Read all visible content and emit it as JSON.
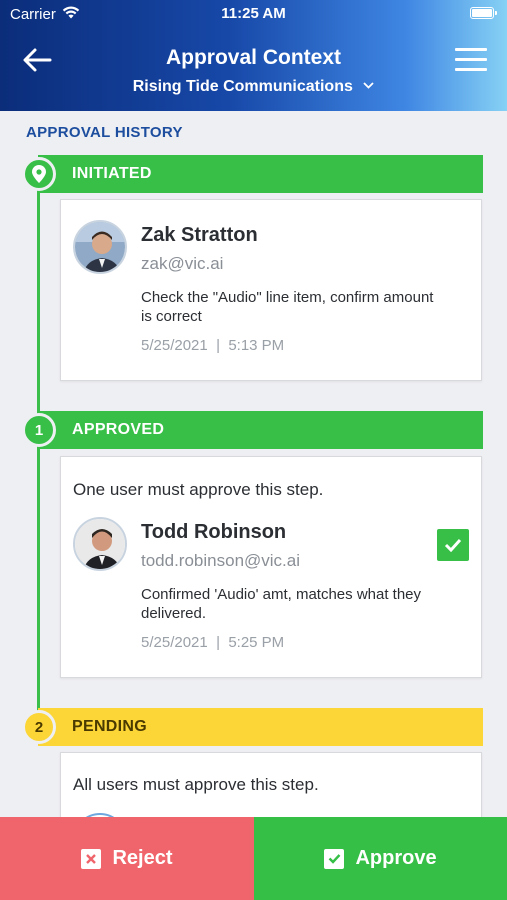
{
  "status_bar": {
    "carrier": "Carrier",
    "time": "11:25 AM"
  },
  "header": {
    "title": "Approval Context",
    "company": "Rising Tide Communications"
  },
  "section_label": "APPROVAL HISTORY",
  "steps": [
    {
      "badge": "",
      "icon": "location-pin-icon",
      "label": "INITIATED",
      "status_color": "#38bf48",
      "entry": {
        "name": "Zak Stratton",
        "email": "zak@vic.ai",
        "comment": "Check the \"Audio\" line item, confirm amount is correct",
        "date": "5/25/2021",
        "time": "5:13 PM"
      }
    },
    {
      "badge": "1",
      "label": "APPROVED",
      "status_color": "#38bf48",
      "rule": "One user must approve this step.",
      "entry": {
        "name": "Todd Robinson",
        "email": "todd.robinson@vic.ai",
        "comment": "Confirmed 'Audio' amt, matches what they delivered.",
        "date": "5/25/2021",
        "time": "5:25 PM",
        "approved": true
      }
    },
    {
      "badge": "2",
      "label": "PENDING",
      "status_color": "#fcd537",
      "rule": "All users must approve this step."
    }
  ],
  "footer": {
    "reject_label": "Reject",
    "approve_label": "Approve"
  },
  "colors": {
    "reject": "#f0656b",
    "approve": "#35bf46",
    "accent": "#1c4d9e"
  }
}
